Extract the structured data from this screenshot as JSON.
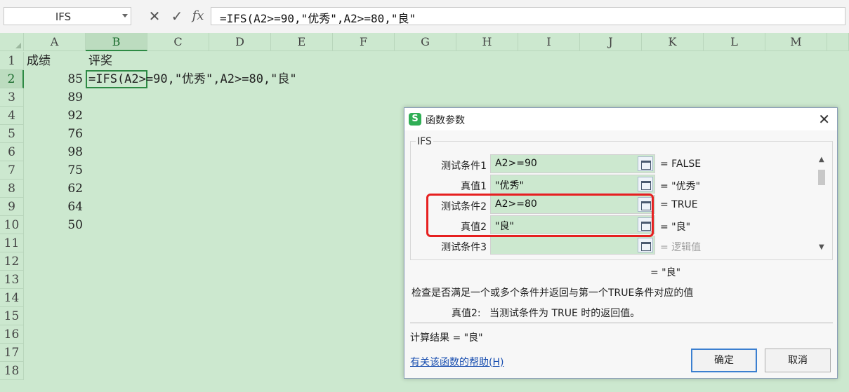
{
  "formula_bar": {
    "name_box": "IFS",
    "icons": [
      "cancel-x-icon",
      "confirm-check-icon",
      "fx-icon"
    ],
    "fx_label": "fx",
    "formula": "=IFS(A2>=90,\"优秀\",A2>=80,\"良\""
  },
  "columns": [
    "A",
    "B",
    "C",
    "D",
    "E",
    "F",
    "G",
    "H",
    "I",
    "J",
    "K",
    "L",
    "M"
  ],
  "rows": [
    "1",
    "2",
    "3",
    "4",
    "5",
    "6",
    "7",
    "8",
    "9",
    "10",
    "11",
    "12",
    "13",
    "14",
    "15",
    "16",
    "17",
    "18"
  ],
  "sheet": {
    "a1": "成绩",
    "b1": "评奖",
    "scores": [
      "85",
      "89",
      "92",
      "76",
      "98",
      "75",
      "62",
      "64",
      "50"
    ],
    "b2_edit": "=IFS(A2>=90,\"优秀\",A2>=80,\"良\""
  },
  "dialog": {
    "title": "函数参数",
    "group_label": "IFS",
    "args": [
      {
        "label": "测试条件1",
        "value": "A2>=90",
        "result": "= FALSE"
      },
      {
        "label": "真值1",
        "value": "\"优秀\"",
        "result": "= \"优秀\""
      },
      {
        "label": "测试条件2",
        "value": "A2>=80",
        "result": "= TRUE"
      },
      {
        "label": "真值2",
        "value": "\"良\"",
        "result": "= \"良\""
      },
      {
        "label": "测试条件3",
        "value": "",
        "result": "= 逻辑值"
      }
    ],
    "overall_result": "= \"良\"",
    "description": "检查是否满足一个或多个条件并返回与第一个TRUE条件对应的值",
    "param_help_label": "真值2:",
    "param_help_text": "当测试条件为 TRUE 时的返回值。",
    "calc_result": "计算结果 = \"良\"",
    "help_link": "有关该函数的帮助(H)",
    "ok_label": "确定",
    "cancel_label": "取消"
  }
}
